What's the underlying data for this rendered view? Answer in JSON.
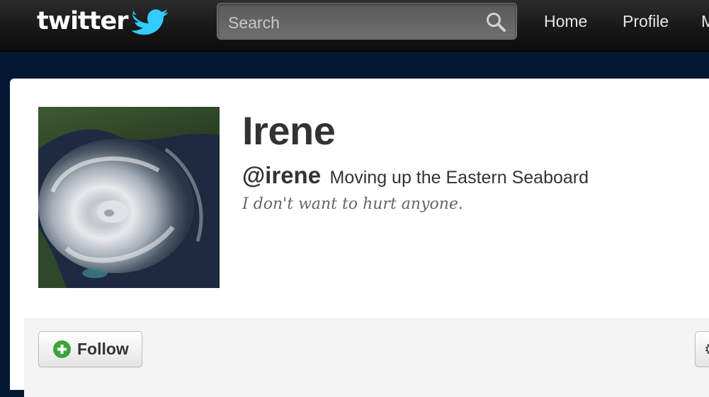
{
  "header": {
    "logo_text": "twitter",
    "search": {
      "placeholder": "Search"
    },
    "nav": {
      "home": "Home",
      "profile": "Profile",
      "messages_partial": "M"
    }
  },
  "profile": {
    "name": "Irene",
    "handle": "@irene",
    "location": "Moving up the Eastern Seaboard",
    "bio": "I don't want to hurt anyone."
  },
  "actions": {
    "follow_label": "Follow",
    "more_label": "⚙"
  },
  "colors": {
    "topbar": "#1b1b1b",
    "page_background": "#041833",
    "twitter_blue": "#33ccff",
    "follow_green": "#3aa53a"
  }
}
